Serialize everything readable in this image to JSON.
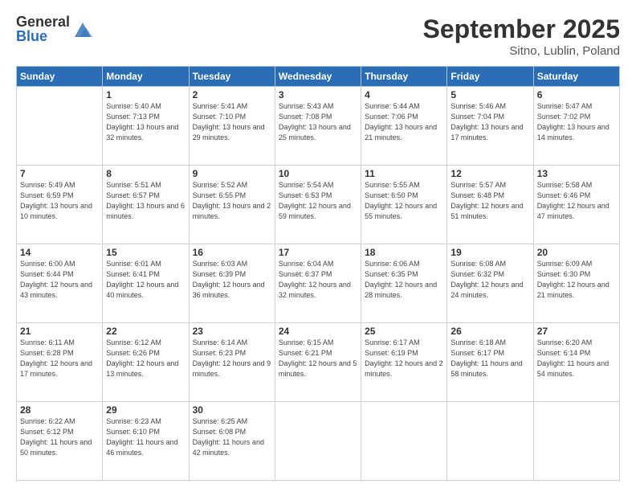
{
  "header": {
    "logo_general": "General",
    "logo_blue": "Blue",
    "month_title": "September 2025",
    "location": "Sitno, Lublin, Poland"
  },
  "days_of_week": [
    "Sunday",
    "Monday",
    "Tuesday",
    "Wednesday",
    "Thursday",
    "Friday",
    "Saturday"
  ],
  "weeks": [
    [
      {
        "day": "",
        "detail": ""
      },
      {
        "day": "1",
        "detail": "Sunrise: 5:40 AM\nSunset: 7:13 PM\nDaylight: 13 hours\nand 32 minutes."
      },
      {
        "day": "2",
        "detail": "Sunrise: 5:41 AM\nSunset: 7:10 PM\nDaylight: 13 hours\nand 29 minutes."
      },
      {
        "day": "3",
        "detail": "Sunrise: 5:43 AM\nSunset: 7:08 PM\nDaylight: 13 hours\nand 25 minutes."
      },
      {
        "day": "4",
        "detail": "Sunrise: 5:44 AM\nSunset: 7:06 PM\nDaylight: 13 hours\nand 21 minutes."
      },
      {
        "day": "5",
        "detail": "Sunrise: 5:46 AM\nSunset: 7:04 PM\nDaylight: 13 hours\nand 17 minutes."
      },
      {
        "day": "6",
        "detail": "Sunrise: 5:47 AM\nSunset: 7:02 PM\nDaylight: 13 hours\nand 14 minutes."
      }
    ],
    [
      {
        "day": "7",
        "detail": "Sunrise: 5:49 AM\nSunset: 6:59 PM\nDaylight: 13 hours\nand 10 minutes."
      },
      {
        "day": "8",
        "detail": "Sunrise: 5:51 AM\nSunset: 6:57 PM\nDaylight: 13 hours\nand 6 minutes."
      },
      {
        "day": "9",
        "detail": "Sunrise: 5:52 AM\nSunset: 6:55 PM\nDaylight: 13 hours\nand 2 minutes."
      },
      {
        "day": "10",
        "detail": "Sunrise: 5:54 AM\nSunset: 6:53 PM\nDaylight: 12 hours\nand 59 minutes."
      },
      {
        "day": "11",
        "detail": "Sunrise: 5:55 AM\nSunset: 6:50 PM\nDaylight: 12 hours\nand 55 minutes."
      },
      {
        "day": "12",
        "detail": "Sunrise: 5:57 AM\nSunset: 6:48 PM\nDaylight: 12 hours\nand 51 minutes."
      },
      {
        "day": "13",
        "detail": "Sunrise: 5:58 AM\nSunset: 6:46 PM\nDaylight: 12 hours\nand 47 minutes."
      }
    ],
    [
      {
        "day": "14",
        "detail": "Sunrise: 6:00 AM\nSunset: 6:44 PM\nDaylight: 12 hours\nand 43 minutes."
      },
      {
        "day": "15",
        "detail": "Sunrise: 6:01 AM\nSunset: 6:41 PM\nDaylight: 12 hours\nand 40 minutes."
      },
      {
        "day": "16",
        "detail": "Sunrise: 6:03 AM\nSunset: 6:39 PM\nDaylight: 12 hours\nand 36 minutes."
      },
      {
        "day": "17",
        "detail": "Sunrise: 6:04 AM\nSunset: 6:37 PM\nDaylight: 12 hours\nand 32 minutes."
      },
      {
        "day": "18",
        "detail": "Sunrise: 6:06 AM\nSunset: 6:35 PM\nDaylight: 12 hours\nand 28 minutes."
      },
      {
        "day": "19",
        "detail": "Sunrise: 6:08 AM\nSunset: 6:32 PM\nDaylight: 12 hours\nand 24 minutes."
      },
      {
        "day": "20",
        "detail": "Sunrise: 6:09 AM\nSunset: 6:30 PM\nDaylight: 12 hours\nand 21 minutes."
      }
    ],
    [
      {
        "day": "21",
        "detail": "Sunrise: 6:11 AM\nSunset: 6:28 PM\nDaylight: 12 hours\nand 17 minutes."
      },
      {
        "day": "22",
        "detail": "Sunrise: 6:12 AM\nSunset: 6:26 PM\nDaylight: 12 hours\nand 13 minutes."
      },
      {
        "day": "23",
        "detail": "Sunrise: 6:14 AM\nSunset: 6:23 PM\nDaylight: 12 hours\nand 9 minutes."
      },
      {
        "day": "24",
        "detail": "Sunrise: 6:15 AM\nSunset: 6:21 PM\nDaylight: 12 hours\nand 5 minutes."
      },
      {
        "day": "25",
        "detail": "Sunrise: 6:17 AM\nSunset: 6:19 PM\nDaylight: 12 hours\nand 2 minutes."
      },
      {
        "day": "26",
        "detail": "Sunrise: 6:18 AM\nSunset: 6:17 PM\nDaylight: 11 hours\nand 58 minutes."
      },
      {
        "day": "27",
        "detail": "Sunrise: 6:20 AM\nSunset: 6:14 PM\nDaylight: 11 hours\nand 54 minutes."
      }
    ],
    [
      {
        "day": "28",
        "detail": "Sunrise: 6:22 AM\nSunset: 6:12 PM\nDaylight: 11 hours\nand 50 minutes."
      },
      {
        "day": "29",
        "detail": "Sunrise: 6:23 AM\nSunset: 6:10 PM\nDaylight: 11 hours\nand 46 minutes."
      },
      {
        "day": "30",
        "detail": "Sunrise: 6:25 AM\nSunset: 6:08 PM\nDaylight: 11 hours\nand 42 minutes."
      },
      {
        "day": "",
        "detail": ""
      },
      {
        "day": "",
        "detail": ""
      },
      {
        "day": "",
        "detail": ""
      },
      {
        "day": "",
        "detail": ""
      }
    ]
  ]
}
